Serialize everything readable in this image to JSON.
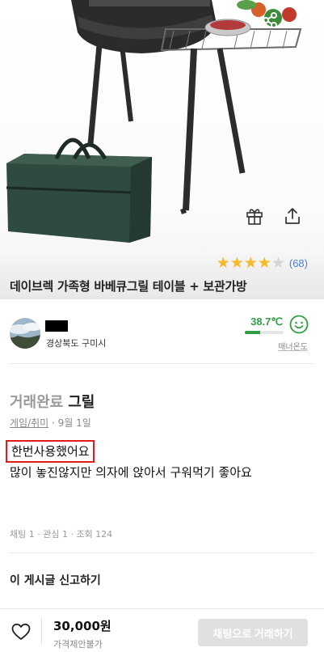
{
  "product": {
    "rating_count": "(68)",
    "stars": 4,
    "stars_max": 5,
    "title": "데이브렉 가족형 바베큐그릴 테이블 + 보관가방"
  },
  "seller": {
    "location": "경상북도 구미시",
    "temperature": "38.7℃",
    "temperature_level_pct": 38.7,
    "manner_label": "매너온도"
  },
  "post": {
    "status": "거래완료",
    "title": "그릴",
    "category": "게임/취미",
    "date": " · 9월 1일",
    "line1": "한번사용했어요",
    "line2": "많이 놓진않지만 의자에 앉아서 구워먹기 좋아요",
    "stats": "채팅 1 · 관심 1 · 조회 124"
  },
  "report_label": "이 게시글 신고하기",
  "bottom": {
    "price": "30,000원",
    "negotiation": "가격제안불가",
    "chat_button": "채팅으로 거래하기"
  },
  "colors": {
    "star_filled": "#f5b92a",
    "star_empty": "#d5d5d5",
    "temperature": "#319e45",
    "highlight_box": "#e21b1b",
    "rating_count": "#4d7fd6"
  },
  "icons": [
    "back-arrow-icon",
    "home-icon",
    "share-icon",
    "more-vertical-icon",
    "gift-icon",
    "share-out-icon",
    "smile-face-icon",
    "heart-icon",
    "star-icon"
  ]
}
